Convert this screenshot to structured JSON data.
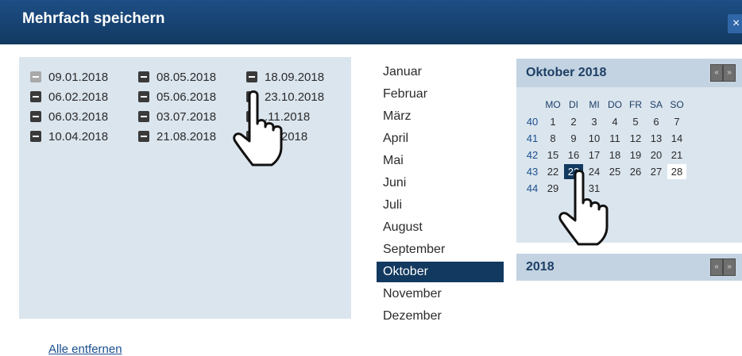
{
  "dialog": {
    "title": "Mehrfach speichern",
    "close_label": "×"
  },
  "selected_dates": {
    "col1": [
      "09.01.2018",
      "06.02.2018",
      "06.03.2018",
      "10.04.2018"
    ],
    "col2": [
      "08.05.2018",
      "05.06.2018",
      "03.07.2018",
      "21.08.2018"
    ],
    "col3": [
      "18.09.2018",
      "23.10.2018",
      ".11.2018",
      "12.2018"
    ]
  },
  "remove_all_label": "Alle entfernen",
  "months": [
    "Januar",
    "Februar",
    "März",
    "April",
    "Mai",
    "Juni",
    "Juli",
    "August",
    "September",
    "Oktober",
    "November",
    "Dezember"
  ],
  "active_month": "Oktober",
  "calendar": {
    "title": "Oktober 2018",
    "day_headers": [
      "MO",
      "DI",
      "MI",
      "DO",
      "FR",
      "SA",
      "SO"
    ],
    "weeks": [
      {
        "wk": "40",
        "days": [
          "1",
          "2",
          "3",
          "4",
          "5",
          "6",
          "7"
        ]
      },
      {
        "wk": "41",
        "days": [
          "8",
          "9",
          "10",
          "11",
          "12",
          "13",
          "14"
        ]
      },
      {
        "wk": "42",
        "days": [
          "15",
          "16",
          "17",
          "18",
          "19",
          "20",
          "21"
        ]
      },
      {
        "wk": "43",
        "days": [
          "22",
          "23",
          "24",
          "25",
          "26",
          "27",
          "28"
        ]
      },
      {
        "wk": "44",
        "days": [
          "29",
          "",
          "31",
          "",
          "",
          "",
          ""
        ]
      }
    ],
    "selected_day": "23",
    "highlighted_day": "28"
  },
  "year_panel": {
    "title": "2018"
  },
  "icons": {
    "remove": "minus-square-icon",
    "nav": "double-chevron-icon",
    "cursor": "hand-pointer-icon"
  }
}
